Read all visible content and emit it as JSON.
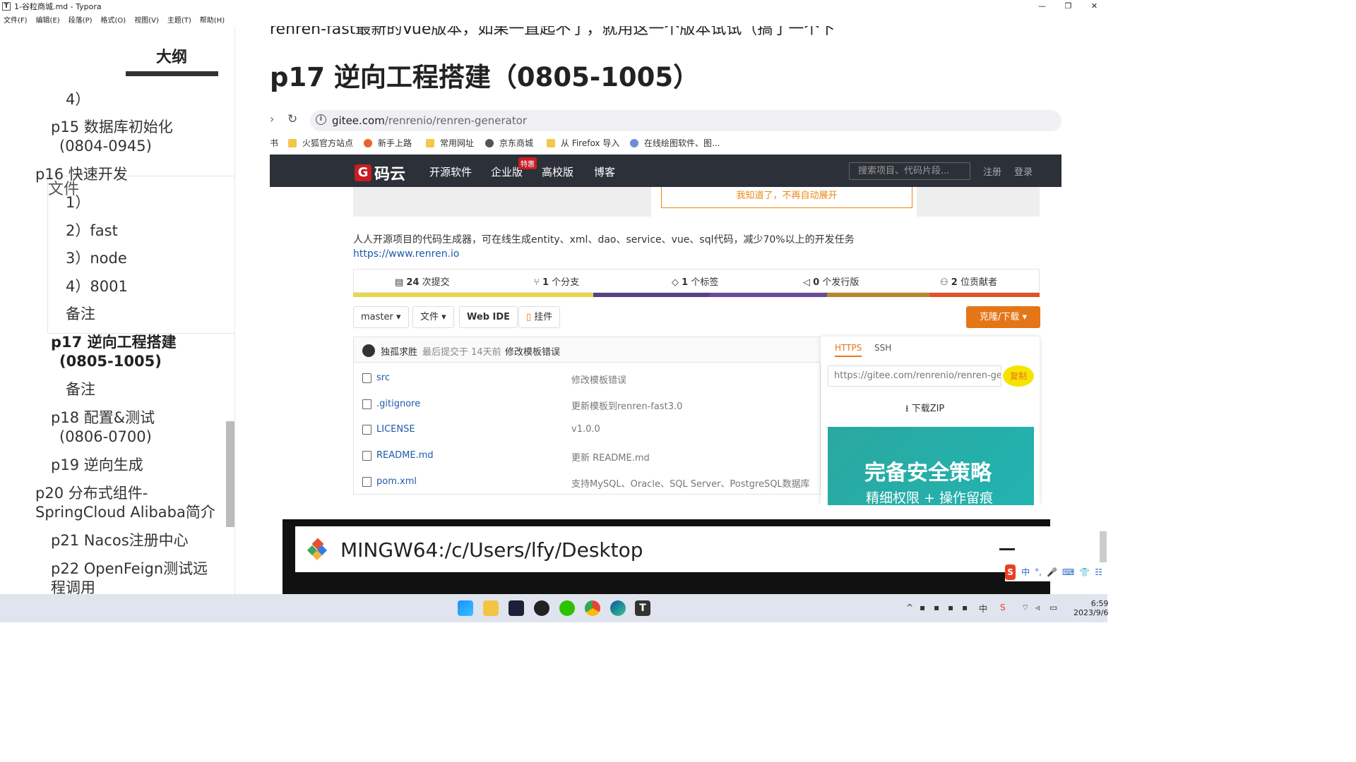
{
  "window": {
    "title": "1-谷粒商城.md - Typora",
    "app_icon": "T",
    "controls": [
      "—",
      "❐",
      "✕"
    ]
  },
  "menu": [
    "文件(F)",
    "编辑(E)",
    "段落(P)",
    "格式(O)",
    "视图(V)",
    "主题(T)",
    "帮助(H)"
  ],
  "sidebar": {
    "tab_files": "文件",
    "tab_outline": "大纲",
    "items": [
      {
        "text": "4）"
      },
      {
        "text": "p15 数据库初始化"
      },
      {
        "text": "(0804-0945)"
      },
      {
        "text": "p16 快速开发"
      },
      {
        "text": "1）"
      },
      {
        "text": "2）fast"
      },
      {
        "text": "3）node"
      },
      {
        "text": "4）8001"
      },
      {
        "text": "备注"
      },
      {
        "text": "p17 逆向工程搭建"
      },
      {
        "text": "(0805-1005)"
      },
      {
        "text": "备注"
      },
      {
        "text": "p18 配置&测试"
      },
      {
        "text": "(0806-0700)"
      },
      {
        "text": "p19 逆向生成"
      },
      {
        "text": "p20 分布式组件-"
      },
      {
        "text": "SpringCloud Alibaba简介"
      },
      {
        "text": "p21 Nacos注册中心"
      },
      {
        "text": "p22 OpenFeign测试远"
      },
      {
        "text": "程调用"
      }
    ]
  },
  "editor": {
    "cut_line": "renren-fast最新的Vue版本，如果一直起不了，就用这一个版本试试（搞了一个下",
    "heading": "p17 逆向工程搭建（0805-1005）"
  },
  "browser": {
    "url_host": "gitee.com",
    "url_path": "/renrenio/renren-generator",
    "bookmarks": [
      "火狐官方站点",
      "新手上路",
      "常用网址",
      "京东商城",
      "从 Firefox 导入",
      "在线绘图软件、图..."
    ],
    "bookmark_prefix": "书",
    "gitee": {
      "logo": "码云",
      "logo_letter": "G",
      "nav": [
        "开源软件",
        "企业版",
        "高校版",
        "博客"
      ],
      "badge": "特惠",
      "search_placeholder": "搜索项目、代码片段...",
      "register": "注册",
      "login": "登录"
    },
    "notice_button": "我知道了，不再自动展开",
    "description": "人人开源项目的代码生成器，可在线生成entity、xml、dao、service、vue、sql代码，减少70%以上的开发任务",
    "homepage": "https://www.renren.io",
    "stats": {
      "commits_num": "24",
      "commits_label": " 次提交",
      "branches_num": "1",
      "branches_label": " 个分支",
      "tags_num": "1",
      "tags_label": " 个标签",
      "releases_num": "0",
      "releases_label": " 个发行版",
      "contributors_num": "2",
      "contributors_label": " 位贡献者"
    },
    "lang_colors": [
      "#e8d84a",
      "#5a3f8a",
      "#6a4b9a",
      "#b8862a",
      "#e0522a"
    ],
    "lang_fractions": [
      0.35,
      0.17,
      0.17,
      0.15,
      0.16
    ],
    "buttons": {
      "branch": "master ▾",
      "file": "文件 ▾",
      "web_ide": "Web IDE",
      "pendant": "挂件",
      "clone": "克隆/下载 ▾"
    },
    "commit": {
      "author": "独孤求胜",
      "time": "最后提交于 14天前",
      "message": "修改模板错误"
    },
    "files": [
      {
        "name": "src",
        "msg": "修改模板错误"
      },
      {
        "name": ".gitignore",
        "msg": "更新模板到renren-fast3.0"
      },
      {
        "name": "LICENSE",
        "msg": "v1.0.0"
      },
      {
        "name": "README.md",
        "msg": "更新 README.md"
      },
      {
        "name": "pom.xml",
        "msg": "支持MySQL、Oracle、SQL Server、PostgreSQL数据库"
      }
    ],
    "clone_panel": {
      "tab_https": "HTTPS",
      "tab_ssh": "SSH",
      "url": "https://gitee.com/renrenio/renren-generator.git",
      "copy": "复制",
      "zip": "下载ZIP",
      "ad_title": "完备安全策略",
      "ad_sub": "精细权限 + 操作留痕"
    }
  },
  "terminal": {
    "title": "MINGW64:/c/Users/lfy/Desktop"
  },
  "ime": {
    "logo": "S",
    "items": [
      "中",
      "°,",
      "🎤",
      "⌨",
      "👕",
      "☷"
    ]
  },
  "taskbar": {
    "time": "6:59",
    "date": "2023/9/6",
    "tray_ime": "中"
  }
}
